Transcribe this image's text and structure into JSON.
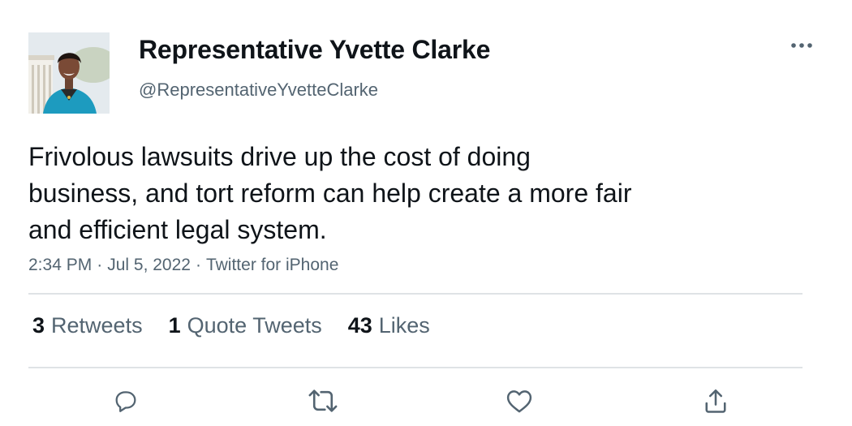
{
  "author": {
    "display_name": "Representative Yvette Clarke",
    "handle": "@RepresentativeYvetteClarke"
  },
  "tweet": {
    "text": "Frivolous lawsuits drive up the cost of doing\nbusiness, and tort reform can help create a more fair\nand efficient legal system.",
    "time": "2:34 PM",
    "date": "Jul 5, 2022",
    "source": "Twitter for iPhone",
    "separator": "·"
  },
  "stats": {
    "retweets": {
      "count": "3",
      "label": "Retweets"
    },
    "quote_tweets": {
      "count": "1",
      "label": "Quote Tweets"
    },
    "likes": {
      "count": "43",
      "label": "Likes"
    }
  },
  "icons": {
    "more": "more-horizontal-icon",
    "reply": "reply-icon",
    "retweet": "retweet-icon",
    "like": "heart-icon",
    "share": "share-icon"
  },
  "colors": {
    "text_primary": "#0f1419",
    "text_secondary": "#536471",
    "divider": "#dfe3e6",
    "icon": "#536471"
  }
}
